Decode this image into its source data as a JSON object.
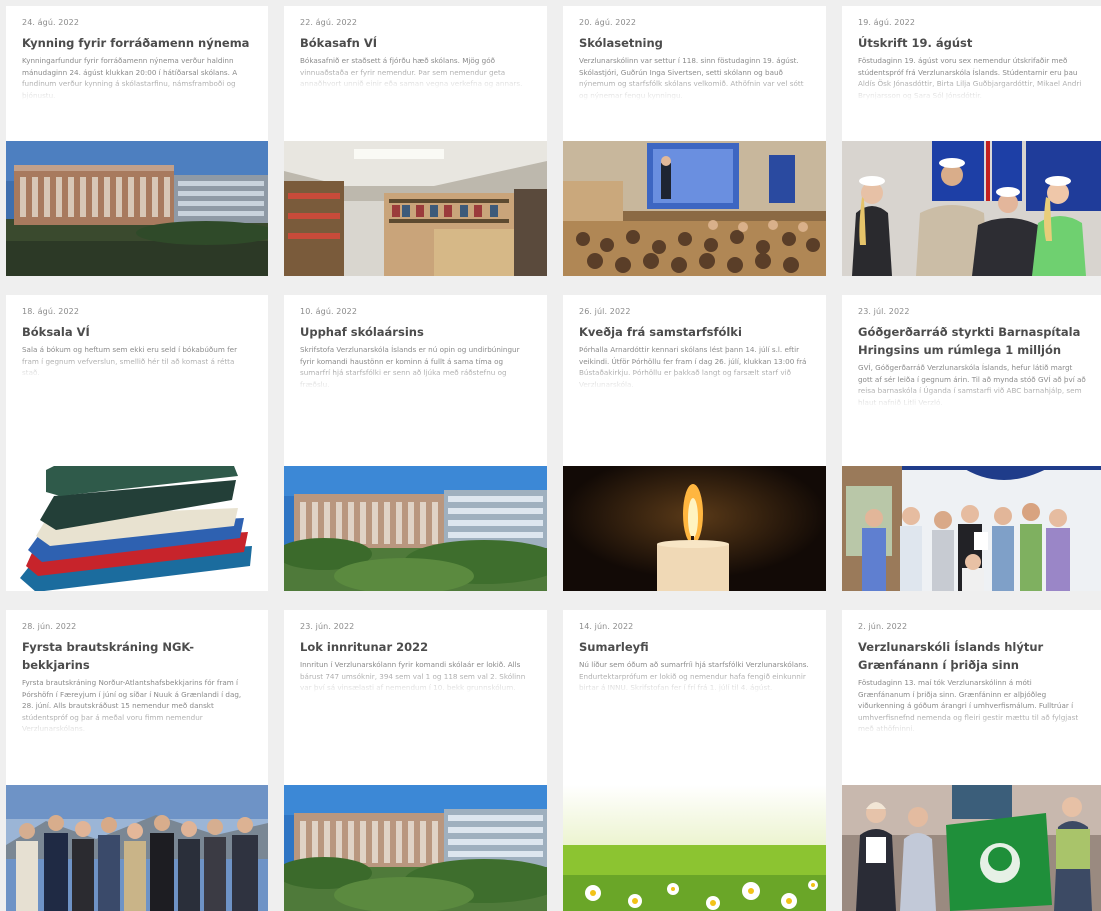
{
  "rows": [
    [
      {
        "date": "24. ágú. 2022",
        "title": "Kynning fyrir forráðamenn nýnema",
        "excerpt": "Kynningarfundur fyrir forráðamenn nýnema verður haldinn mánudaginn 24. ágúst klukkan 20:00 í hátíðarsal skólans. A fundinum verður kynning á skólastarfinu, námsframboði og þjónustu.",
        "image": "school-building"
      },
      {
        "date": "22. ágú. 2022",
        "title": "Bókasafn VÍ",
        "excerpt": "Bókasafnið er staðsett á fjórðu hæð skólans. Mjög góð vinnuaðstaða er fyrir nemendur. Þar sem nemendur geta annaðhvort unnið einir eða saman vegna verkefna og annars.",
        "image": "library"
      },
      {
        "date": "20. ágú. 2022",
        "title": "Skólasetning",
        "excerpt": "Verzlunarskólinn var settur í 118. sinn föstudaginn 19. ágúst. Skólastjóri, Guðrún Inga Sivertsen, setti skólann og bauð nýnemum og starfsfólk skólans velkomið. Athöfnin var vel sótt og nýnemar fengu kynningu.",
        "image": "lecture"
      },
      {
        "date": "19. ágú. 2022",
        "title": "Útskrift 19. ágúst",
        "excerpt": "Föstudaginn 19. ágúst voru sex nemendur útskrifaðir með stúdentspróf frá Verzlunarskóla Íslands. Stúdentarnir eru þau Aldís Ösk Jónasdóttir, Birta Lilja Guðbjargardóttir, Mikael Andri Brynjarsson og Sara Sól Jónsdóttir.",
        "image": "graduates"
      }
    ],
    [
      {
        "date": "18. ágú. 2022",
        "title": "Bóksala VÍ",
        "excerpt": "Sala á bókum og heftum sem ekki eru seld í bókabúðum fer fram í gegnum vefverslun, smellið hér til að komast á rétta stað.",
        "image": "books"
      },
      {
        "date": "10. ágú. 2022",
        "title": "Upphaf skólaársins",
        "excerpt": "Skrifstofa Verzlunarskóla Íslands er nú opin og undirbúningur fyrir komandi haustönn er kominn á fullt á sama tíma og sumarfrí hjá starfsfólki er senn að ljúka með ráðstefnu og fræðslu.",
        "image": "school-building-green"
      },
      {
        "date": "26. júl. 2022",
        "title": "Kveðja frá samstarfsfólki",
        "excerpt": "Þórhalla Arnardóttir kennari skólans lést þann 14. júlí s.l. eftir veikindi. Útför Þórhöllu fer fram í dag 26. júlí, klukkan 13:00 frá Bústaðakirkju. Þórhöllu er þakkað langt og farsælt starf við Verzlunarskóla.",
        "image": "candle"
      },
      {
        "date": "23. júl. 2022",
        "title": "Góðgerðarráð styrkti Barnaspítala Hringsins um rúmlega 1 milljón",
        "excerpt": "GVÍ, Góðgerðarráð Verzlunarskóla Íslands, hefur látið margt gott af sér leiða í gegnum árin. Til að mynda stóð GVÍ að því að reisa barnaskóla í Úganda í samstarfi við ABC barnahjálp, sem hlaut nafnið Litli Verzló.",
        "image": "hospital-group"
      }
    ],
    [
      {
        "date": "28. jún. 2022",
        "title": "Fyrsta brautskráning NGK-bekkjarins",
        "excerpt": "Fyrsta brautskráning Norður-Atlantshafsbekkjarins fór fram í Þórshöfn í Færeyjum í júní og síðar í Nuuk á Grænlandi í dag, 28. júní. Alls brautskráðust 15 nemendur með danskt stúdentspróf og þar á meðal voru fimm nemendur Verzlunarskólans.",
        "image": "ngk-group"
      },
      {
        "date": "23. jún. 2022",
        "title": "Lok innritunar 2022",
        "excerpt": "Innritun í Verzlunarskólann fyrir komandi skólaár er lokið. Alls bárust 747 umsóknir, 394 sem val 1 og 118 sem val 2. Skólinn var því sá vinsælasti af nemendum í 10. bekk grunnskólum.",
        "image": "school-building-green"
      },
      {
        "date": "14. jún. 2022",
        "title": "Sumarleyfi",
        "excerpt": "Nú líður sem óðum að sumarfríi hjá starfsfólki Verzlunarskólans. Endurtektarprófum er lokið og nemendur hafa fengið einkunnir birtar á INNU. Skrifstofan fer í frí frá 1. júlí til 4. ágúst.",
        "image": "daisies"
      },
      {
        "date": "2. jún. 2022",
        "title": "Verzlunarskóli Íslands hlýtur Grænfánann í þriðja sinn",
        "excerpt": "Föstudaginn 13. maí tók Verzlunarskólinn á móti Grænfánanum í þriðja sinn. Grænfáninn er alþjóðleg viðurkenning á góðum árangri í umhverfismálum. Fulltrúar í umhverfisnefnd nemenda og fleiri gestir mættu til að fylgjast með athöfninni.",
        "image": "green-flag"
      }
    ]
  ],
  "colors": {
    "page_bg": "#efefef",
    "card_bg": "#ffffff",
    "title": "#4c4c4c",
    "text": "#8a8a8a"
  }
}
